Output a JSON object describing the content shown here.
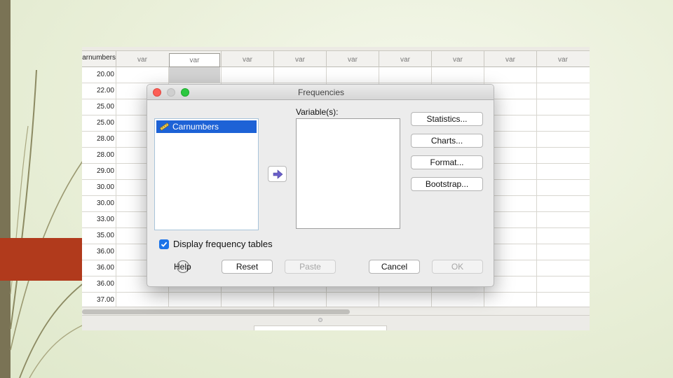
{
  "spreadsheet": {
    "first_column_header": "Carnumbers",
    "column_header": "var",
    "column_count": 9,
    "values": [
      "20.00",
      "22.00",
      "25.00",
      "25.00",
      "28.00",
      "28.00",
      "29.00",
      "30.00",
      "30.00",
      "33.00",
      "35.00",
      "36.00",
      "36.00",
      "36.00",
      "37.00"
    ]
  },
  "dialog": {
    "title": "Frequencies",
    "source_items": [
      "Carnumbers"
    ],
    "variables_label": "Variable(s):",
    "buttons": {
      "statistics": "Statistics...",
      "charts": "Charts...",
      "format": "Format...",
      "bootstrap": "Bootstrap...",
      "help": "Help",
      "reset": "Reset",
      "paste": "Paste",
      "cancel": "Cancel",
      "ok": "OK"
    },
    "checkbox_label": "Display frequency tables",
    "checkbox_checked": true
  },
  "icons": {
    "source_item": "ruler-icon",
    "move": "arrow-right-icon",
    "checkbox": "checkmark-icon"
  },
  "colors": {
    "selection": "#1d62d6",
    "checkbox": "#1a73e8",
    "slide_bar": "#7a7355",
    "slide_tab": "#b13a1c"
  }
}
